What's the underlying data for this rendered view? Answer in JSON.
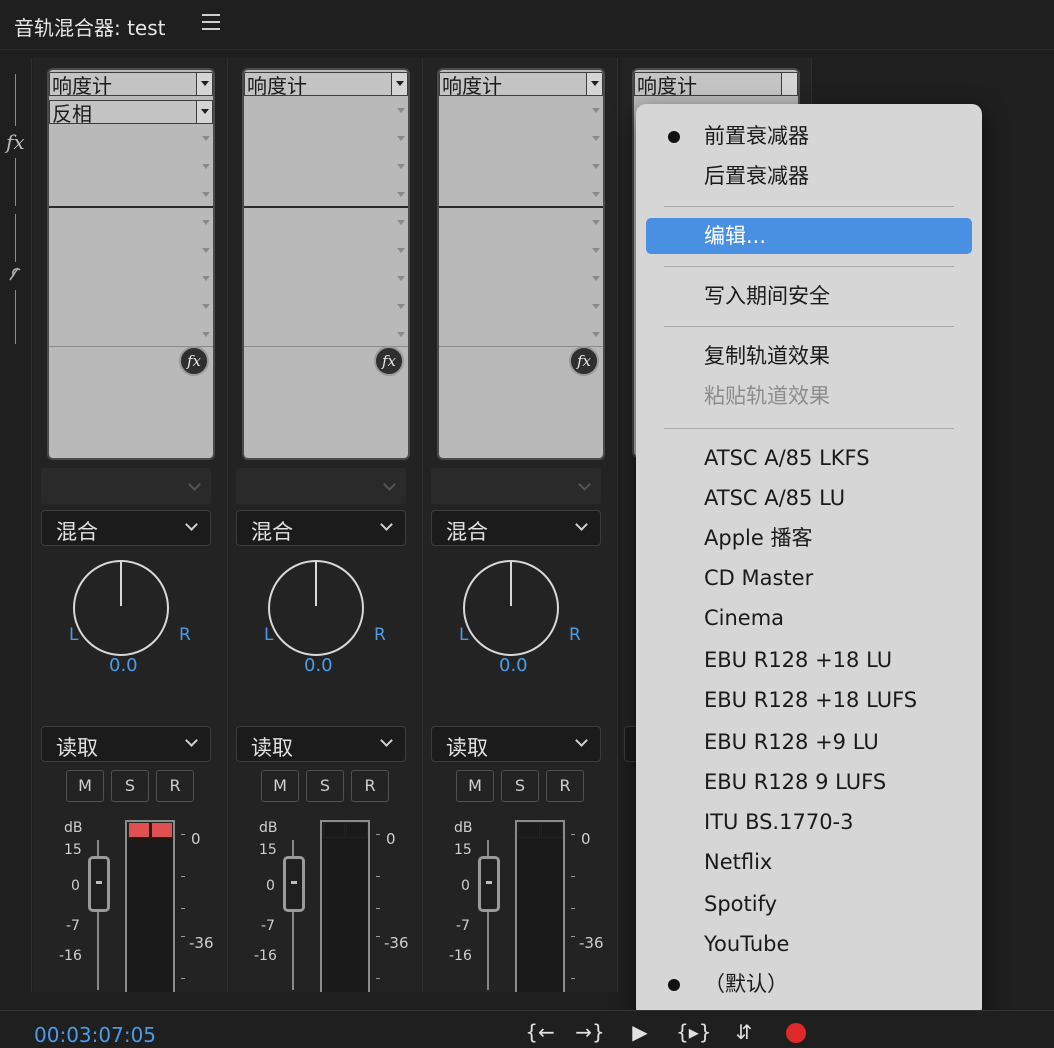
{
  "header": {
    "title": "音轨混合器: test"
  },
  "rail": {
    "fx_label": "fx"
  },
  "strips": [
    {
      "effects": [
        "响度计",
        "反相"
      ],
      "mode": "混合",
      "pan_L": "L",
      "pan_R": "R",
      "pan_value": "0.0",
      "automation": "读取",
      "m": "M",
      "s": "S",
      "r": "R",
      "db_labels": {
        "db": "dB",
        "p15": "15",
        "zero": "0",
        "m7": "-7",
        "m16": "-16"
      },
      "meter_labels": {
        "zero": "0",
        "m36": "-36"
      },
      "clip": true
    },
    {
      "effects": [
        "响度计"
      ],
      "mode": "混合",
      "pan_L": "L",
      "pan_R": "R",
      "pan_value": "0.0",
      "automation": "读取",
      "m": "M",
      "s": "S",
      "r": "R",
      "db_labels": {
        "db": "dB",
        "p15": "15",
        "zero": "0",
        "m7": "-7",
        "m16": "-16"
      },
      "meter_labels": {
        "zero": "0",
        "m36": "-36"
      },
      "clip": false
    },
    {
      "effects": [
        "响度计"
      ],
      "mode": "混合",
      "pan_L": "L",
      "pan_R": "R",
      "pan_value": "0.0",
      "automation": "读取",
      "m": "M",
      "s": "S",
      "r": "R",
      "db_labels": {
        "db": "dB",
        "p15": "15",
        "zero": "0",
        "m7": "-7",
        "m16": "-16"
      },
      "meter_labels": {
        "zero": "0",
        "m36": "-36"
      },
      "clip": false
    }
  ],
  "strip4": {
    "effect": "响度计"
  },
  "context_menu": {
    "items": [
      {
        "label": "前置衰减器",
        "checked": true
      },
      {
        "label": "后置衰减器",
        "checked": false
      },
      {
        "label": "编辑...",
        "highlighted": true
      },
      {
        "label": "写入期间安全"
      },
      {
        "label": "复制轨道效果"
      },
      {
        "label": "粘贴轨道效果",
        "disabled": true
      },
      {
        "label": "ATSC A/85 LKFS"
      },
      {
        "label": "ATSC A/85 LU"
      },
      {
        "label": "Apple 播客"
      },
      {
        "label": "CD Master"
      },
      {
        "label": "Cinema"
      },
      {
        "label": "EBU R128 +18 LU"
      },
      {
        "label": "EBU R128 +18 LUFS"
      },
      {
        "label": "EBU R128 +9 LU"
      },
      {
        "label": "EBU R128 9 LUFS"
      },
      {
        "label": "ITU BS.1770-3"
      },
      {
        "label": "Netflix"
      },
      {
        "label": "Spotify"
      },
      {
        "label": "YouTube"
      },
      {
        "label": "（默认）",
        "checked": true
      }
    ]
  },
  "footer": {
    "timecode": "00:03:07:05"
  },
  "colors": {
    "accent": "#4a9ce8",
    "highlight": "#4a90e2",
    "clip": "#e05050",
    "record": "#e02a2a"
  }
}
